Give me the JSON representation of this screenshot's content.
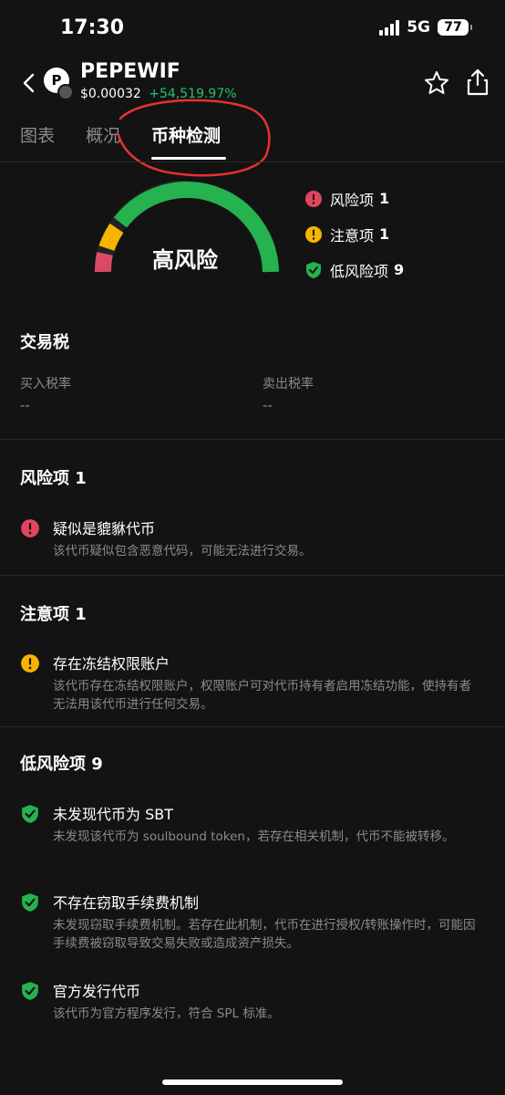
{
  "status": {
    "time": "17:30",
    "network": "5G",
    "battery": "77"
  },
  "token": {
    "logo_letter": "P",
    "name": "PEPEWIF",
    "price": "$0.00032",
    "change": "+54,519.97%"
  },
  "tabs": [
    {
      "label": "图表"
    },
    {
      "label": "概况"
    },
    {
      "label": "币种检测"
    }
  ],
  "gauge": {
    "label": "高风险"
  },
  "legend": [
    {
      "label": "风险项",
      "count": "1",
      "icon": "danger-icon",
      "color": "#e0455f"
    },
    {
      "label": "注意项",
      "count": "1",
      "icon": "warning-icon",
      "color": "#f7b500"
    },
    {
      "label": "低风险项",
      "count": "9",
      "icon": "shield-check-icon",
      "color": "#25b24f"
    }
  ],
  "tax": {
    "title": "交易税",
    "buy_label": "买入税率",
    "buy_value": "--",
    "sell_label": "卖出税率",
    "sell_value": "--"
  },
  "risk": {
    "title": "风险项 1",
    "items": [
      {
        "title": "疑似是貔貅代币",
        "desc": "该代币疑似包含恶意代码，可能无法进行交易。"
      }
    ]
  },
  "caution": {
    "title": "注意项 1",
    "items": [
      {
        "title": "存在冻结权限账户",
        "desc": "该代币存在冻结权限账户，权限账户可对代币持有者启用冻结功能，使持有者无法用该代币进行任何交易。"
      }
    ]
  },
  "low": {
    "title": "低风险项 9",
    "items": [
      {
        "title": "未发现代币为 SBT",
        "desc": "未发现该代币为 soulbound token，若存在相关机制，代币不能被转移。"
      },
      {
        "title": "不存在窃取手续费机制",
        "desc": "未发现窃取手续费机制。若存在此机制，代币在进行授权/转账操作时，可能因手续费被窃取导致交易失败或造成资产损失。"
      },
      {
        "title": "官方发行代币",
        "desc": "该代币为官方程序发行，符合 SPL 标准。"
      }
    ]
  },
  "colors": {
    "danger": "#e0455f",
    "warning": "#f7b500",
    "safe": "#25b24f",
    "positive": "#25c26e",
    "annotation": "#e8312f"
  }
}
